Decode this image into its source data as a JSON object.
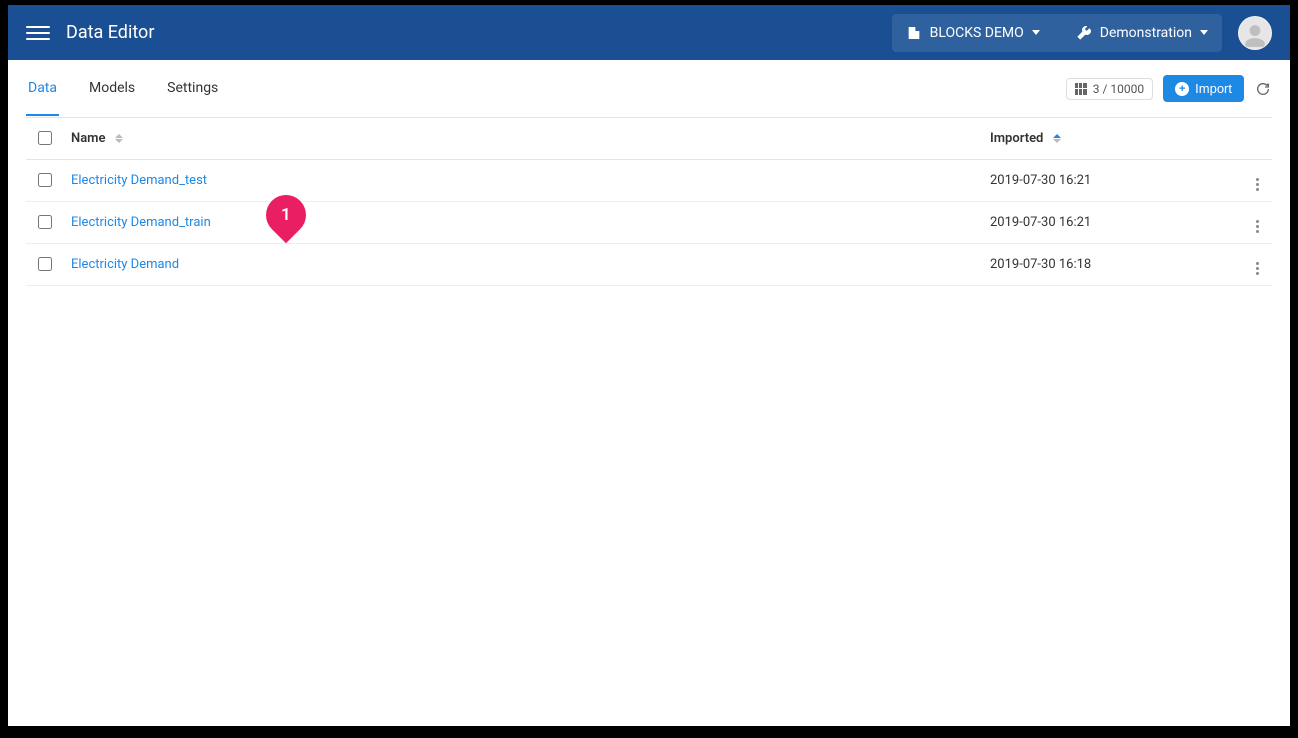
{
  "header": {
    "title": "Data Editor",
    "crumb1": "BLOCKS DEMO",
    "crumb2": "Demonstration"
  },
  "tabs": {
    "data": "Data",
    "models": "Models",
    "settings": "Settings",
    "active": "data"
  },
  "toolbar": {
    "count": "3 / 10000",
    "import_label": "Import"
  },
  "table": {
    "headers": {
      "name": "Name",
      "imported": "Imported"
    },
    "rows": [
      {
        "name": "Electricity Demand_test",
        "imported": "2019-07-30 16:21"
      },
      {
        "name": "Electricity Demand_train",
        "imported": "2019-07-30 16:21"
      },
      {
        "name": "Electricity Demand",
        "imported": "2019-07-30 16:18"
      }
    ]
  },
  "callout": {
    "number": "1"
  }
}
